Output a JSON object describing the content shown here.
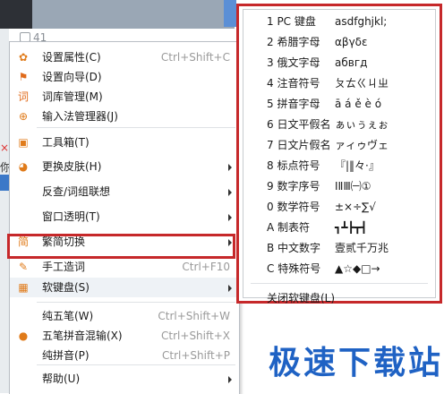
{
  "background": {
    "count": "41",
    "side_text": "你",
    "red_mark": "×"
  },
  "menu": {
    "items": [
      {
        "label": "设置属性(C)",
        "shortcut": "Ctrl+Shift+C",
        "icon": "gear-icon",
        "glyph": "✿",
        "glyph_color": "#e07b1a",
        "submenu": false
      },
      {
        "label": "设置向导(D)",
        "shortcut": "",
        "icon": "flag-icon",
        "glyph": "⚑",
        "glyph_color": "#e06a1a",
        "submenu": false
      },
      {
        "label": "词库管理(M)",
        "shortcut": "",
        "icon": "dictionary-icon",
        "glyph": "词",
        "glyph_color": "#e06a1a",
        "submenu": false
      },
      {
        "label": "输入法管理器(J)",
        "shortcut": "",
        "icon": "input-manager-icon",
        "glyph": "⊕",
        "glyph_color": "#e07b1a",
        "submenu": false
      },
      {
        "label": "工具箱(T)",
        "shortcut": "",
        "icon": "toolbox-icon",
        "glyph": "▣",
        "glyph_color": "#e07b1a",
        "submenu": false
      },
      {
        "label": "更换皮肤(H)",
        "shortcut": "",
        "icon": "skin-icon",
        "glyph": "◕",
        "glyph_color": "#e07b1a",
        "submenu": true
      },
      {
        "label": "反查/词组联想",
        "shortcut": "",
        "icon": "",
        "glyph": "",
        "glyph_color": "",
        "submenu": true
      },
      {
        "label": "窗口透明(T)",
        "shortcut": "",
        "icon": "",
        "glyph": "",
        "glyph_color": "",
        "submenu": true
      },
      {
        "label": "繁简切换",
        "shortcut": "",
        "icon": "traditional-simplified-icon",
        "glyph": "简",
        "glyph_color": "#e07b1a",
        "submenu": true
      },
      {
        "label": "手工造词",
        "shortcut": "Ctrl+F10",
        "icon": "manual-word-icon",
        "glyph": "✎",
        "glyph_color": "#e07b1a",
        "submenu": false
      },
      {
        "label": "软键盘(S)",
        "shortcut": "",
        "icon": "soft-keyboard-icon",
        "glyph": "▦",
        "glyph_color": "#e07b1a",
        "submenu": true
      },
      {
        "label": "纯五笔(W)",
        "shortcut": "Ctrl+Shift+W",
        "icon": "",
        "glyph": "",
        "glyph_color": "",
        "submenu": false
      },
      {
        "label": "五笔拼音混输(X)",
        "shortcut": "Ctrl+Shift+X",
        "icon": "radio-dot-icon",
        "glyph": "●",
        "glyph_color": "#e07b1a",
        "submenu": false
      },
      {
        "label": "纯拼音(P)",
        "shortcut": "Ctrl+Shift+P",
        "icon": "",
        "glyph": "",
        "glyph_color": "",
        "submenu": false
      },
      {
        "label": "帮助(U)",
        "shortcut": "",
        "icon": "",
        "glyph": "",
        "glyph_color": "",
        "submenu": true
      }
    ]
  },
  "submenu": {
    "items": [
      {
        "name": "1 PC 键盘",
        "sample": "asdfghjkl;"
      },
      {
        "name": "2 希腊字母",
        "sample": "αβγδε"
      },
      {
        "name": "3 俄文字母",
        "sample": "абвгд"
      },
      {
        "name": "4 注音符号",
        "sample": "ㄆㄊㄍㄐㄓ"
      },
      {
        "name": "5 拼音字母",
        "sample": "ā á ě è ó"
      },
      {
        "name": "6 日文平假名",
        "sample": "ぁぃぅぇぉ"
      },
      {
        "name": "7 日文片假名",
        "sample": "ァィゥヴェ"
      },
      {
        "name": "8 标点符号",
        "sample": "『|‖々·』"
      },
      {
        "name": "9 数字序号",
        "sample": "ⅠⅡⅢ㈠①"
      },
      {
        "name": "0 数学符号",
        "sample": "±×÷∑√"
      },
      {
        "name": "A 制表符",
        "sample": "┓┻┣┳┫"
      },
      {
        "name": "B 中文数字",
        "sample": "壹贰千万兆"
      },
      {
        "name": "C 特殊符号",
        "sample": "▲☆◆□→"
      }
    ],
    "close_label": "关闭软键盘(L)"
  },
  "watermark": "极速下载站"
}
